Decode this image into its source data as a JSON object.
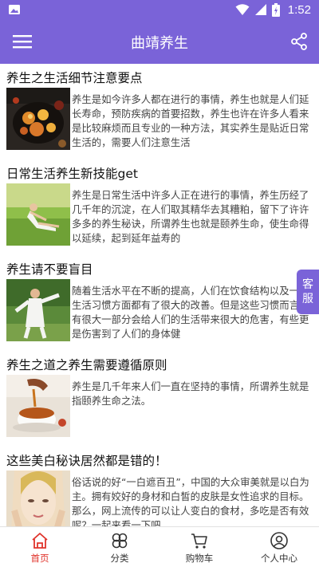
{
  "status_bar": {
    "time": "1:52",
    "icons": [
      "gallery-icon",
      "wifi-icon",
      "signal-icon",
      "battery-icon"
    ]
  },
  "header": {
    "title": "曲靖养生",
    "menu_icon": "hamburger-menu-icon",
    "share_icon": "share-icon"
  },
  "articles": [
    {
      "title": "养生之生活细节注意要点",
      "description": "养生是如今许多人都在进行的事情，养生也就是人们延长寿命，预防疾病的首要招数，养生也许在许多人看来是比较麻烦而且专业的一种方法，其实养生是贴近日常生活的，需要人们注意生活"
    },
    {
      "title": "日常生活养生新技能get",
      "description": "养生是日常生活中许多人正在进行的事情，养生历经了几千年的沉淀，在人们取其精华去其糟粕，留下了许许多多的养生秘诀，所谓养生也就是颐养生命，使生命得以延续，起到延年益寿的"
    },
    {
      "title": "养生请不要盲目",
      "description": "随着生活水平在不断的提高，人们在饮食结构以及一些生活习惯方面都有了很大的改善。但是这些习惯而言，有很大一部分会给人们的生活带来很大的危害，有些更是伤害到了人们的身体健"
    },
    {
      "title": "养生之道之养生需要遵循原则",
      "description": "养生是几千年来人们一直在坚持的事情，所谓养生就是指颐养生命之法。"
    },
    {
      "title": "这些美白秘诀居然都是错的！",
      "description": "俗话说的好“一白遮百丑”，中国的大众审美就是以白为主。拥有姣好的身材和白皙的皮肤是女性追求的目标。那么，网上流传的可以让人变白的食材，多吃是否有效呢？一起来看一下吧。"
    }
  ],
  "service_button": {
    "label": "客服"
  },
  "tabs": [
    {
      "label": "首页",
      "icon": "home-icon",
      "active": true
    },
    {
      "label": "分类",
      "icon": "category-icon",
      "active": false
    },
    {
      "label": "购物车",
      "icon": "cart-icon",
      "active": false
    },
    {
      "label": "个人中心",
      "icon": "user-icon",
      "active": false
    }
  ],
  "colors": {
    "primary": "#7a63d8",
    "active_tab": "#e0342c"
  }
}
